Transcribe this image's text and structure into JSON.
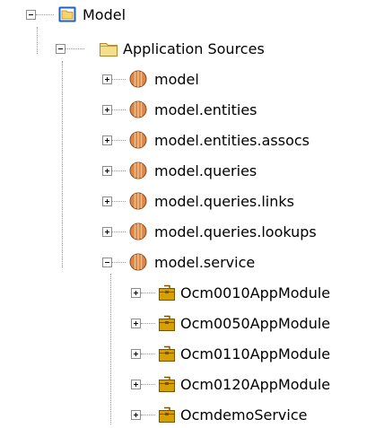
{
  "tree": {
    "root": {
      "label": "Model",
      "expanded": true,
      "icon": "project-folder-icon"
    },
    "app_sources": {
      "label": "Application Sources",
      "expanded": true,
      "icon": "folder-icon"
    },
    "packages": [
      {
        "label": "model",
        "expanded": false,
        "icon": "package-icon"
      },
      {
        "label": "model.entities",
        "expanded": false,
        "icon": "package-icon"
      },
      {
        "label": "model.entities.assocs",
        "expanded": false,
        "icon": "package-icon"
      },
      {
        "label": "model.queries",
        "expanded": false,
        "icon": "package-icon"
      },
      {
        "label": "model.queries.links",
        "expanded": false,
        "icon": "package-icon"
      },
      {
        "label": "model.queries.lookups",
        "expanded": false,
        "icon": "package-icon"
      },
      {
        "label": "model.service",
        "expanded": true,
        "icon": "package-icon"
      }
    ],
    "app_modules": [
      {
        "label": "Ocm0010AppModule",
        "expanded": false,
        "icon": "application-module-icon"
      },
      {
        "label": "Ocm0050AppModule",
        "expanded": false,
        "icon": "application-module-icon"
      },
      {
        "label": "Ocm0110AppModule",
        "expanded": false,
        "icon": "application-module-icon"
      },
      {
        "label": "Ocm0120AppModule",
        "expanded": false,
        "icon": "application-module-icon"
      },
      {
        "label": "OcmdemoService",
        "expanded": false,
        "icon": "application-module-icon"
      }
    ]
  },
  "colors": {
    "project_folder_border": "#1f5fbf",
    "project_folder_fill": "#f6d46a",
    "folder_fill": "#f4df8e",
    "folder_border": "#b08a2a",
    "package_fill": "#d9884a",
    "package_stripe": "#f3c48f",
    "module_fill": "#d6a000",
    "module_border": "#7a5200"
  }
}
